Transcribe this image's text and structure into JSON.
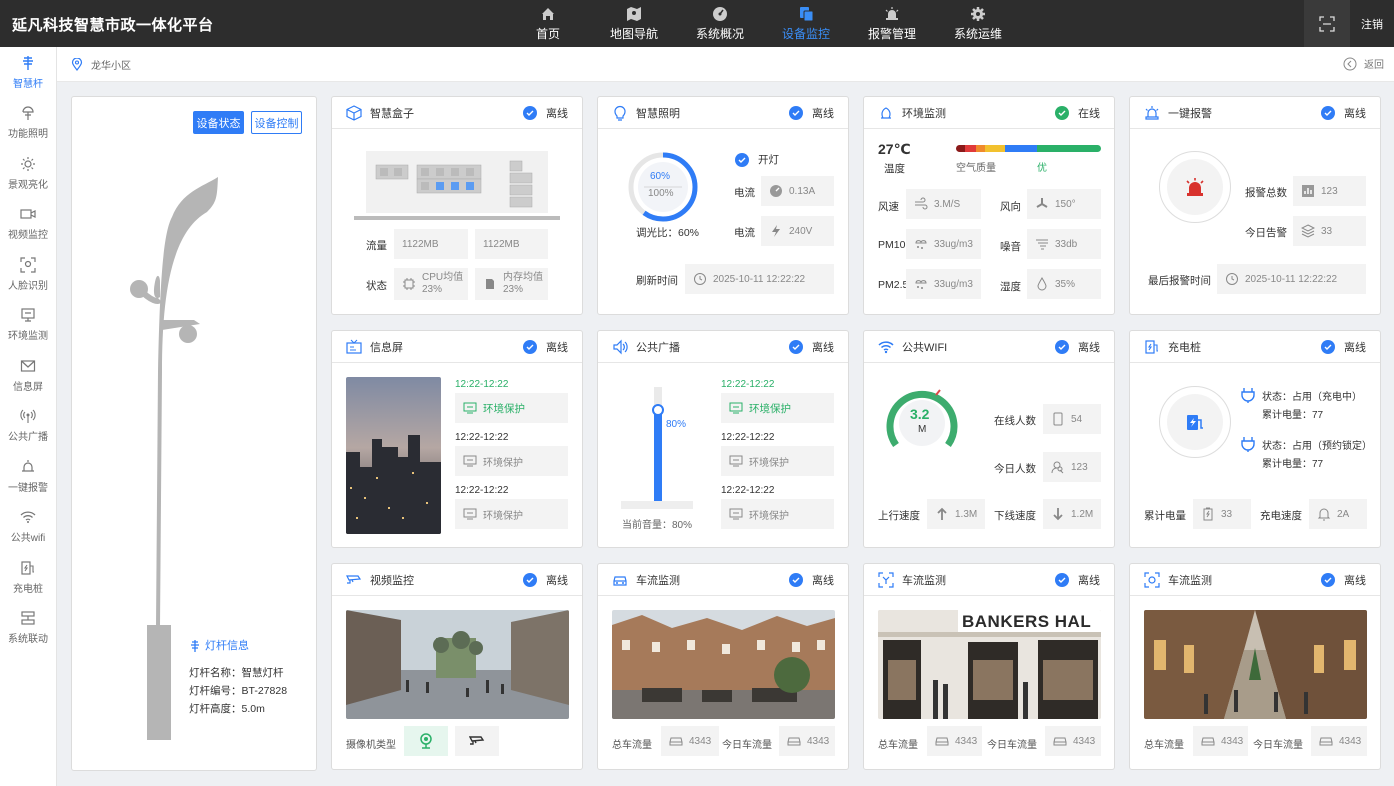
{
  "app_title": "延凡科技智慧市政一体化平台",
  "nav": [
    {
      "label": "首页",
      "icon": "home-icon",
      "active": false
    },
    {
      "label": "地图导航",
      "icon": "map-icon",
      "active": false
    },
    {
      "label": "系统概况",
      "icon": "dashboard-icon",
      "active": false
    },
    {
      "label": "设备监控",
      "icon": "device-icon",
      "active": true
    },
    {
      "label": "报警管理",
      "icon": "alarm-icon",
      "active": false
    },
    {
      "label": "系统运维",
      "icon": "gear-icon",
      "active": false
    }
  ],
  "logout_label": "注销",
  "sidebar": [
    {
      "label": "智慧杆",
      "icon": "pole-icon",
      "active": true
    },
    {
      "label": "功能照明",
      "icon": "lamp-icon",
      "active": false
    },
    {
      "label": "景观亮化",
      "icon": "sun-icon",
      "active": false
    },
    {
      "label": "视频监控",
      "icon": "camera-icon",
      "active": false
    },
    {
      "label": "人脸识别",
      "icon": "face-icon",
      "active": false
    },
    {
      "label": "环境监测",
      "icon": "env-icon",
      "active": false
    },
    {
      "label": "信息屏",
      "icon": "mail-icon",
      "active": false
    },
    {
      "label": "公共广播",
      "icon": "broadcast-icon",
      "active": false
    },
    {
      "label": "一键报警",
      "icon": "alarm-icon",
      "active": false
    },
    {
      "label": "公共wifi",
      "icon": "wifi-icon",
      "active": false
    },
    {
      "label": "充电桩",
      "icon": "charger-icon",
      "active": false
    },
    {
      "label": "系统联动",
      "icon": "link-icon",
      "active": false
    }
  ],
  "breadcrumb": {
    "location": "龙华小区",
    "back_label": "返回"
  },
  "pole": {
    "status_btn": "设备状态",
    "control_btn": "设备控制",
    "info_title": "灯杆信息",
    "name": "灯杆名称：智慧灯杆",
    "code": "灯杆编号：BT-27828",
    "height": "灯杆高度：5.0m"
  },
  "cards": {
    "box": {
      "title": "智慧盒子",
      "status": "离线",
      "flow_label": "流量",
      "flow1": "1122MB",
      "flow2": "1122MB",
      "state_label": "状态",
      "cpu_line1": "CPU均值",
      "cpu_line2": "23%",
      "mem_line1": "内存均值",
      "mem_line2": "23%"
    },
    "light": {
      "title": "智慧照明",
      "status": "离线",
      "ring_top": "60%",
      "ring_bottom": "100%",
      "ratio": 0.6,
      "dim_label": "调光比：60%",
      "on_label": "开灯",
      "cur_label1": "电流",
      "cur_val1": "0.13A",
      "cur_label2": "电流",
      "cur_val2": "240V",
      "refresh_label": "刷新时间",
      "refresh_val": "2025-10-11  12:22:22"
    },
    "env": {
      "title": "环境监测",
      "status": "在线",
      "temp": "27℃",
      "temp_label": "温度",
      "aq_label": "空气质量",
      "aq_val": "优",
      "wind_label": "风速",
      "wind_val": "3.M/S",
      "dir_label": "风向",
      "dir_val": "150°",
      "pm10_label": "PM10",
      "pm10_val": "33ug/m3",
      "noise_label": "噪音",
      "noise_val": "33db",
      "pm25_label": "PM2.5",
      "pm25_val": "33ug/m3",
      "hum_label": "湿度",
      "hum_val": "35%"
    },
    "alarm": {
      "title": "一键报警",
      "status": "离线",
      "total_label": "报警总数",
      "total_val": "123",
      "today_label": "今日告警",
      "today_val": "33",
      "last_label": "最后报警时间",
      "last_val": "2025-10-11  12:22:22"
    },
    "screen": {
      "title": "信息屏",
      "status": "离线",
      "items": [
        {
          "time": "12:22-12:22",
          "text": "环境保护",
          "active": true
        },
        {
          "time": "12:22-12:22",
          "text": "环境保护",
          "active": false
        },
        {
          "time": "12:22-12:22",
          "text": "环境保护",
          "active": false
        }
      ]
    },
    "broadcast": {
      "title": "公共广播",
      "status": "离线",
      "volume": 0.8,
      "volume_tag": "80%",
      "volume_label": "当前音量：80%",
      "items": [
        {
          "time": "12:22-12:22",
          "text": "环境保护",
          "active": true
        },
        {
          "time": "12:22-12:22",
          "text": "环境保护",
          "active": false
        },
        {
          "time": "12:22-12:22",
          "text": "环境保护",
          "active": false
        }
      ]
    },
    "wifi": {
      "title": "公共WIFI",
      "status": "离线",
      "speed": "3.2",
      "unit": "M",
      "online_label": "在线人数",
      "online_val": "54",
      "today_label": "今日人数",
      "today_val": "123",
      "up_label": "上行速度",
      "up_val": "1.3M",
      "down_label": "下线速度",
      "down_val": "1.2M"
    },
    "charger": {
      "title": "充电桩",
      "status": "离线",
      "s1_status": "状态：占用（充电中）",
      "s1_power": "累计电量：77",
      "s2_status": "状态：占用（预约锁定）",
      "s2_power": "累计电量：77",
      "total_label": "累计电量",
      "total_val": "33",
      "speed_label": "充电速度",
      "speed_val": "2A"
    },
    "video": {
      "title": "视频监控",
      "status": "离线",
      "cam_label": "摄像机类型"
    },
    "traffic1": {
      "title": "车流监测",
      "status": "离线",
      "total_label": "总车流量",
      "total_val": "4343",
      "today_label": "今日车流量",
      "today_val": "4343"
    },
    "traffic2": {
      "title": "车流监测",
      "status": "离线",
      "total_label": "总车流量",
      "total_val": "4343",
      "today_label": "今日车流量",
      "today_val": "4343",
      "sign": "BANKERS HAL"
    },
    "traffic3": {
      "title": "车流监测",
      "status": "离线",
      "total_label": "总车流量",
      "total_val": "4343",
      "today_label": "今日车流量",
      "today_val": "4343"
    }
  },
  "colors": {
    "accent": "#2f7cf6",
    "online": "#2ab068",
    "topbar": "#2d2d2d",
    "alarm": "#d8322d"
  }
}
